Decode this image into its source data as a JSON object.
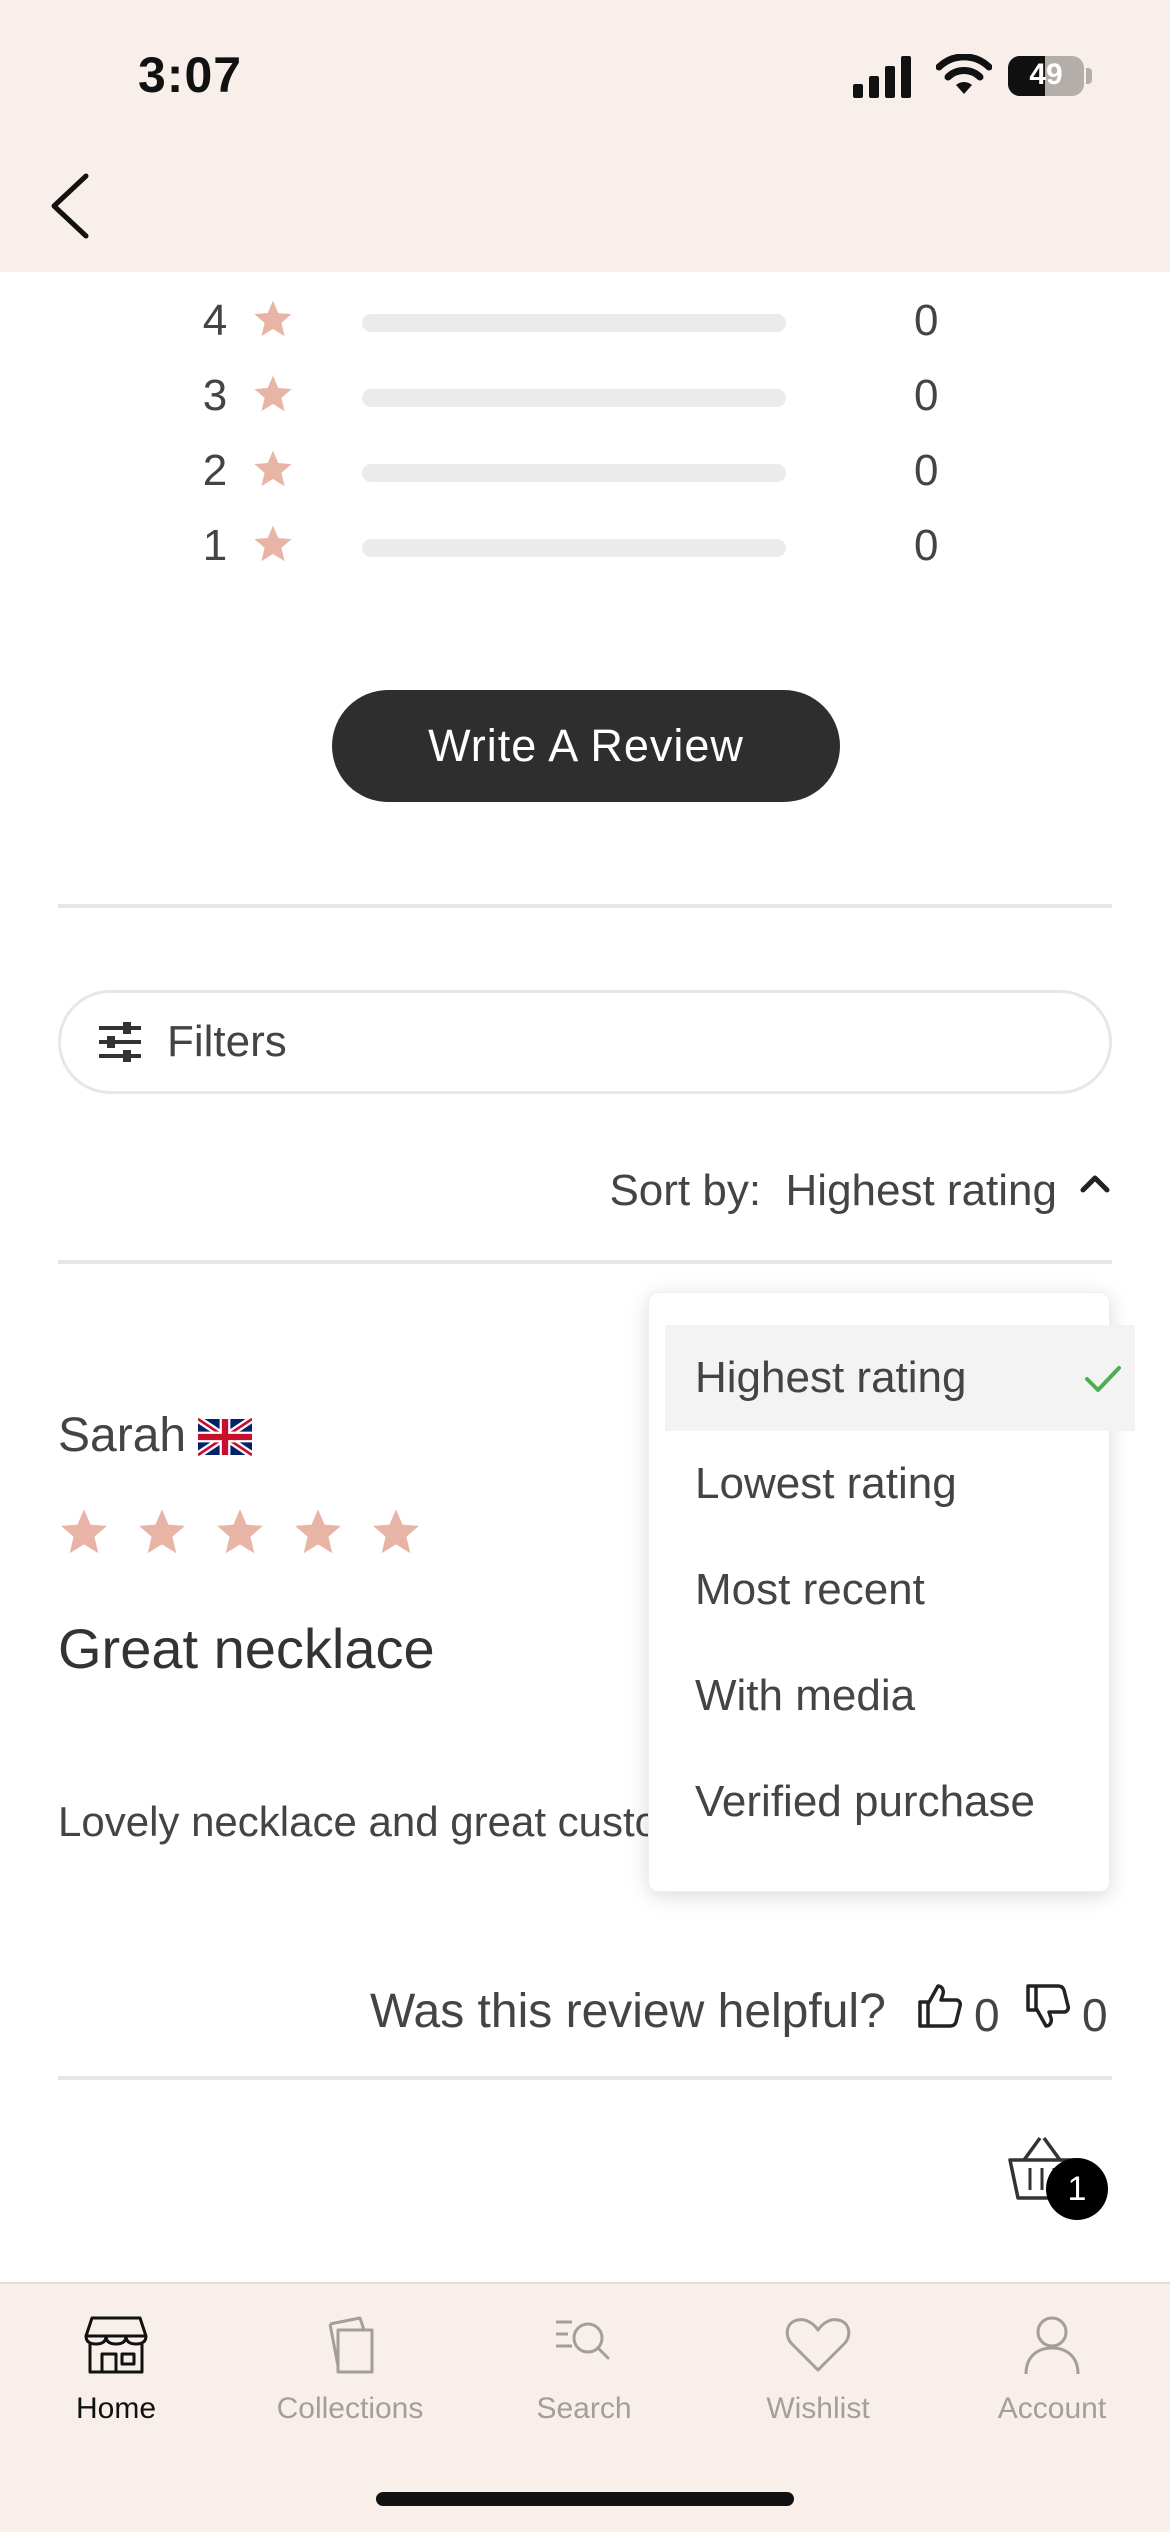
{
  "status_bar": {
    "time": "3:07",
    "battery_percent": "49"
  },
  "rating_breakdown": [
    {
      "stars": "4",
      "count": "0",
      "fill_fraction": 0
    },
    {
      "stars": "3",
      "count": "0",
      "fill_fraction": 0
    },
    {
      "stars": "2",
      "count": "0",
      "fill_fraction": 0
    },
    {
      "stars": "1",
      "count": "0",
      "fill_fraction": 0
    }
  ],
  "write_review_label": "Write A Review",
  "filters_label": "Filters",
  "sort": {
    "label": "Sort by:",
    "value": "Highest rating",
    "options": [
      "Highest rating",
      "Lowest rating",
      "Most recent",
      "With media",
      "Verified purchase"
    ],
    "selected_index": 0
  },
  "review": {
    "author": "Sarah",
    "country_flag": "uk-flag-icon",
    "rating": 5,
    "title": "Great necklace",
    "body": "Lovely necklace and great custo",
    "helpful_prompt": "Was this review helpful?",
    "helpful_up": "0",
    "helpful_down": "0"
  },
  "cart": {
    "count": "1"
  },
  "bottom_nav": [
    {
      "label": "Home",
      "icon": "store-icon",
      "active": true
    },
    {
      "label": "Collections",
      "icon": "collections-icon",
      "active": false
    },
    {
      "label": "Search",
      "icon": "search-icon",
      "active": false
    },
    {
      "label": "Wishlist",
      "icon": "heart-icon",
      "active": false
    },
    {
      "label": "Account",
      "icon": "user-icon",
      "active": false
    }
  ],
  "colors": {
    "header_bg": "#f8efea",
    "star": "#e8b4a6",
    "button_dark": "#2e2e2e",
    "check_green": "#4caf50"
  }
}
